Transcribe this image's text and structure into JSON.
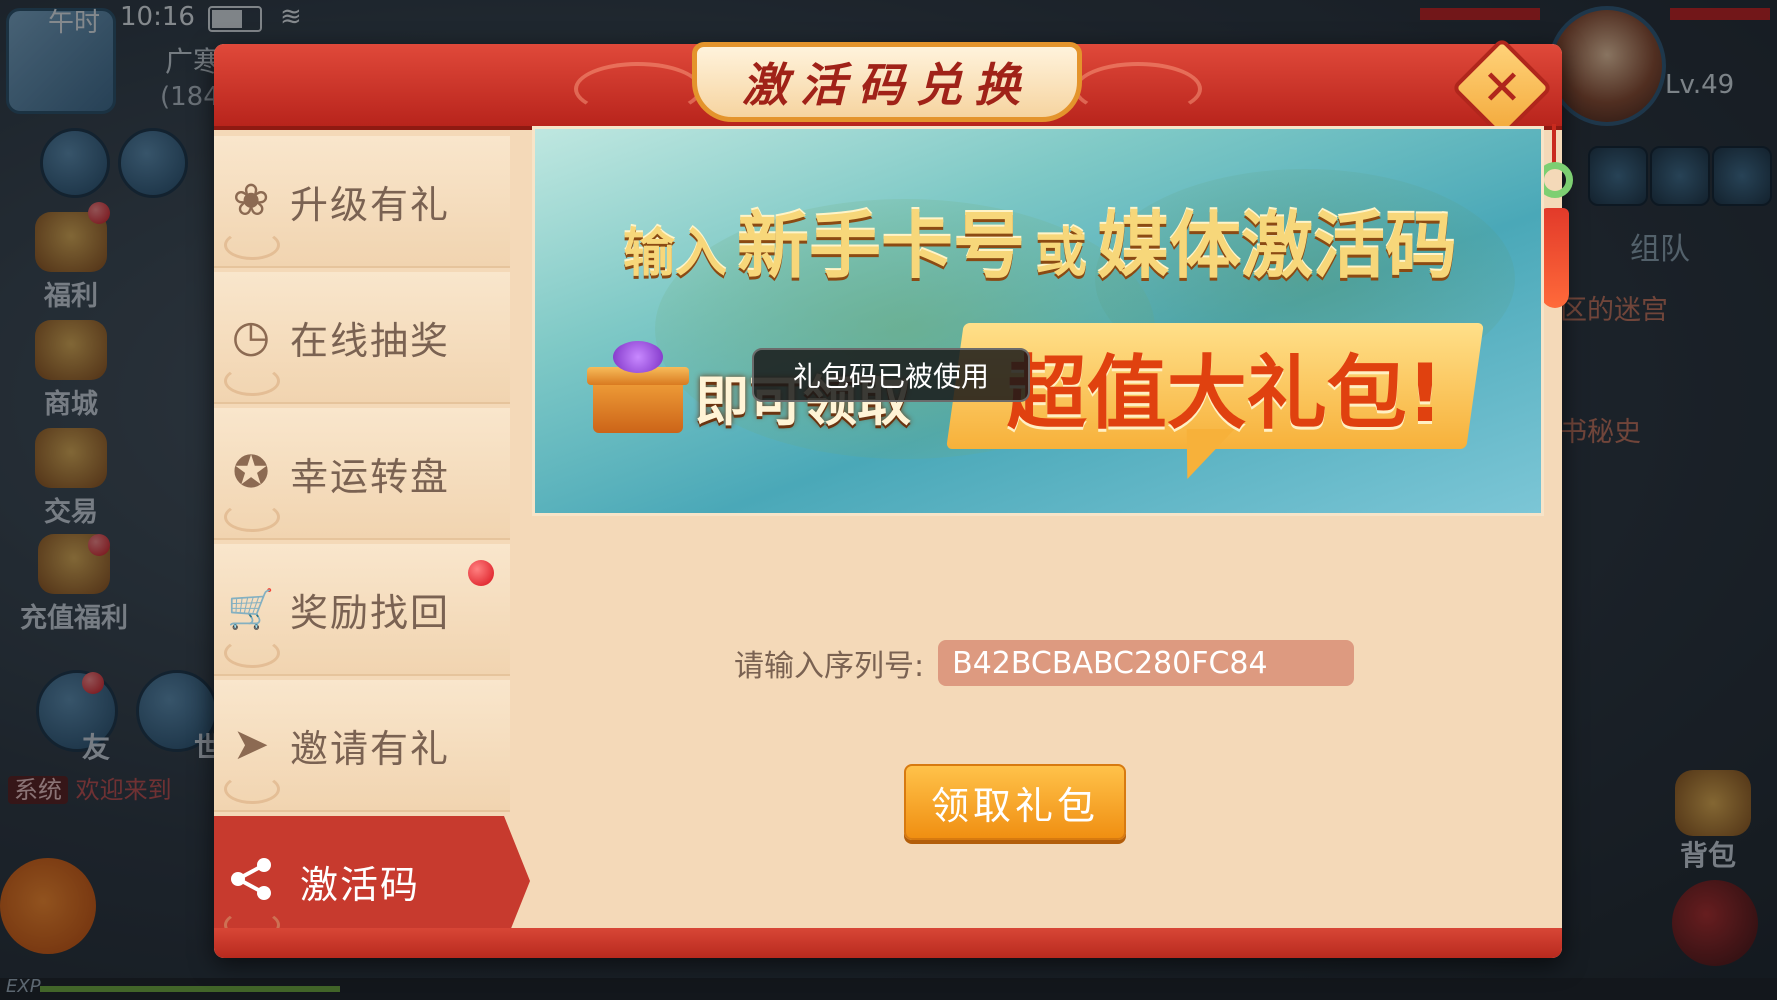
{
  "status": {
    "time_period": "午时",
    "clock": "10:16"
  },
  "hud_left": {
    "map_name": "广寒",
    "coords": "(184",
    "icons": [
      {
        "label": "福利",
        "icon": "gift-icon"
      },
      {
        "label": "商城",
        "icon": "shop-icon"
      },
      {
        "label": "交易",
        "icon": "trade-icon"
      },
      {
        "label": "充值福利",
        "icon": "recharge-icon"
      }
    ],
    "friend_label": "友",
    "world_label": "世",
    "chat_channel": "系统",
    "chat_text": "欢迎来到"
  },
  "hud_right": {
    "level": "Lv.49",
    "team_tab": "组队",
    "quest1": "区的迷宫",
    "quest2": "书秘史",
    "bag_label": "背包"
  },
  "exp_label": "EXP",
  "dialog": {
    "title": "激活码兑换",
    "close_glyph": "✕",
    "menu": [
      {
        "label": "升级有礼",
        "icon": "lotus-icon",
        "glyph": "❀",
        "active": false,
        "dot": false
      },
      {
        "label": "在线抽奖",
        "icon": "clock-icon",
        "glyph": "◷",
        "active": false,
        "dot": false
      },
      {
        "label": "幸运转盘",
        "icon": "wheel-icon",
        "glyph": "✪",
        "active": false,
        "dot": false
      },
      {
        "label": "奖励找回",
        "icon": "cart-icon",
        "glyph": "🛒",
        "active": false,
        "dot": true
      },
      {
        "label": "邀请有礼",
        "icon": "paper-plane-icon",
        "glyph": "➤",
        "active": false,
        "dot": false
      },
      {
        "label": "激活码",
        "icon": "share-icon",
        "glyph": "⋖",
        "active": true,
        "dot": false
      }
    ],
    "banner": {
      "part1": "输入",
      "part2": "新手卡号",
      "part3": "或",
      "part4": "媒体激活码",
      "line2": "即可领取",
      "bubble": "超值大礼包!"
    },
    "serial_label": "请输入序列号:",
    "serial_value": "B42BCBABC280FC84",
    "claim_button": "领取礼包"
  },
  "toast": "礼包码已被使用",
  "colors": {
    "panel_bg": "#f4d9b8",
    "header_red": "#c73a2e",
    "button_orange": "#f5a62a",
    "input_bg": "#dd9a80"
  }
}
